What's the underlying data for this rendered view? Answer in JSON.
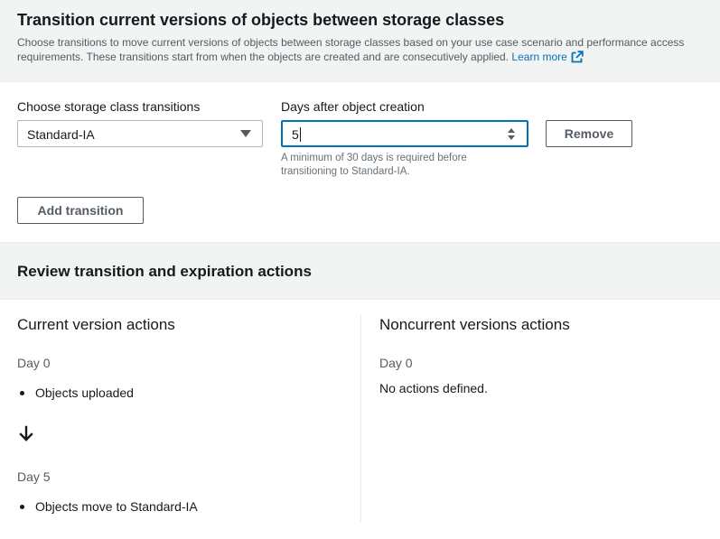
{
  "transitions_section": {
    "title": "Transition current versions of objects between storage classes",
    "description": "Choose transitions to move current versions of objects between storage classes based on your use case scenario and performance access requirements. These transitions start from when the objects are created and are consecutively applied.",
    "learn_more": "Learn more",
    "link_color": "#0073bb",
    "icon": "external-link-icon"
  },
  "transition_row": {
    "storage_class_label": "Choose storage class transitions",
    "storage_class_value": "Standard-IA",
    "days_label": "Days after object creation",
    "days_value": "5",
    "hint": "A minimum of 30 days is required before transitioning to Standard-IA.",
    "remove_label": "Remove"
  },
  "add_transition_label": "Add transition",
  "review": {
    "title": "Review transition and expiration actions",
    "current": {
      "title": "Current version actions",
      "steps": [
        {
          "day": "Day 0",
          "action": "Objects uploaded"
        },
        {
          "day": "Day 5",
          "action": "Objects move to Standard-IA"
        }
      ],
      "arrow_icon": "arrow-down-icon"
    },
    "noncurrent": {
      "title": "Noncurrent versions actions",
      "day": "Day 0",
      "message": "No actions defined."
    }
  },
  "colors": {
    "focus_border": "#0073bb",
    "header_bg": "#f2f3f3",
    "text": "#16191f",
    "secondary_text": "#545b64"
  }
}
